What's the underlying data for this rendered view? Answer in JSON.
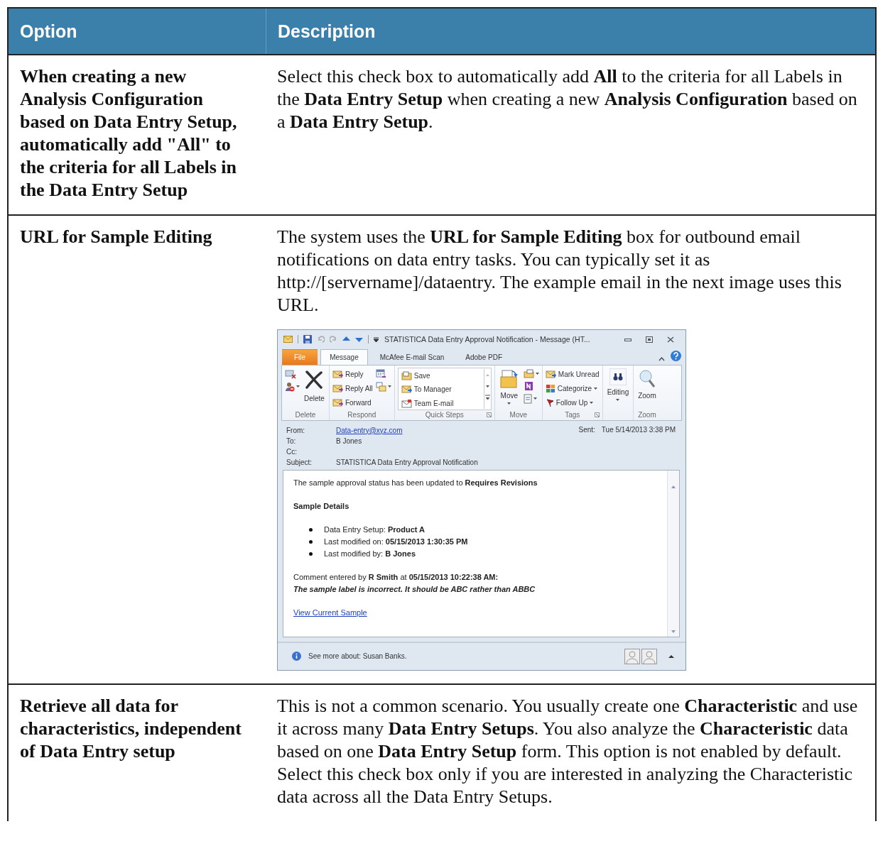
{
  "table": {
    "columns": [
      "Option",
      "Description"
    ],
    "rows": [
      {
        "option": "When creating a new Analysis Configuration based on Data Entry Setup, automatically add \"All\" to the criteria for all Labels in the Data Entry Setup",
        "description": "Select this check box to automatically add **All** to the criteria for all Labels in the **Data Entry Setup** when creating a new **Analysis Configuration** based on a **Data Entry Setup**."
      },
      {
        "option": "URL for Sample Editing",
        "description": "The system uses the **URL for Sample Editing** box for outbound email notifications on data entry tasks. You can typically set it as http://[servername]/dataentry. The example email in the next image uses this URL.",
        "email_window": {
          "title": "STATISTICA Data Entry Approval Notification  -  Message (HT...",
          "tabs": [
            {
              "label": "File",
              "kind": "file",
              "selected": false
            },
            {
              "label": "Message",
              "kind": "tab",
              "selected": true
            },
            {
              "label": "McAfee E-mail Scan",
              "kind": "tab",
              "selected": false
            },
            {
              "label": "Adobe PDF",
              "kind": "tab",
              "selected": false
            }
          ],
          "groups": [
            {
              "kind": "delete",
              "label": "Delete",
              "buttons": [
                "Delete"
              ]
            },
            {
              "kind": "respond",
              "label": "Respond",
              "buttons": [
                "Reply",
                "Reply All",
                "Forward"
              ]
            },
            {
              "kind": "quick_steps",
              "label": "Quick Steps",
              "buttons": [
                "Save",
                "To Manager",
                "Team E-mail"
              ]
            },
            {
              "kind": "move",
              "label": "Move",
              "buttons": [
                "Move"
              ]
            },
            {
              "kind": "tags",
              "label": "Tags",
              "buttons": [
                "Mark Unread",
                "Categorize",
                "Follow Up"
              ]
            },
            {
              "kind": "editing",
              "buttons": [
                "Editing"
              ]
            },
            {
              "kind": "zoom",
              "label": "Zoom",
              "buttons": [
                "Zoom"
              ]
            }
          ],
          "header": {
            "from_label": "From:",
            "from": "Data-entry@xyz.com",
            "to_label": "To:",
            "to": "B Jones",
            "cc_label": "Cc:",
            "subject_label": "Subject:",
            "subject": "STATISTICA Data Entry Approval Notification",
            "sent_label": "Sent:",
            "sent": "Tue 5/14/2013 3:38 PM"
          },
          "body": [
            {
              "kind": "paragraph",
              "text": "The sample approval status has been updated to **Requires Revisions**"
            },
            {
              "kind": "heading",
              "text": "Sample Details"
            },
            {
              "kind": "bullets",
              "items": [
                "Data Entry Setup: **Product A**",
                "Last modified on: **05/15/2013 1:30:35 PM**",
                "Last modified by: **B Jones**"
              ]
            },
            {
              "kind": "comment",
              "text": "Comment entered by **R Smith** at **05/15/2013 10:22:38 AM:**",
              "note": "The sample label is incorrect. It should be ABC rather than ABBC"
            },
            {
              "kind": "link",
              "text": "View Current Sample"
            }
          ],
          "footer": {
            "text": "See more about: Susan Banks."
          }
        }
      },
      {
        "option": "Retrieve all data for characteristics, independent of Data Entry setup",
        "description": "This is not a common scenario. You usually create one **Characteristic** and use it across many **Data Entry Setups**. You also analyze the **Characteristic** data based on one **Data Entry Setup** form. This option is not enabled by default. Select this check box only if you are interested in analyzing the Characteristic data across all the Data Entry Setups."
      }
    ]
  }
}
